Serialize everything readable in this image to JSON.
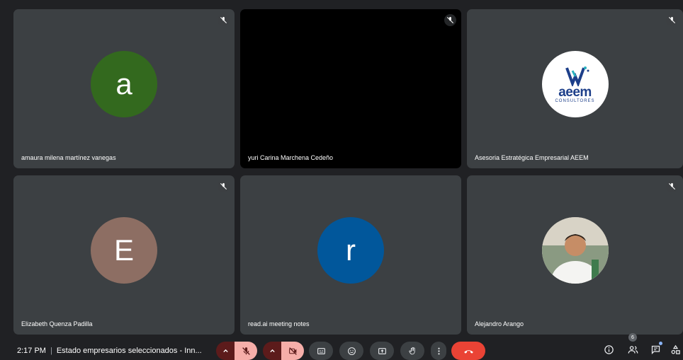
{
  "participants": [
    {
      "name": "amaura milena martínez vanegas",
      "initial": "a",
      "avatar_color": "#33691e",
      "muted": true
    },
    {
      "name": "yuri Carina Marchena Cedeño",
      "initial": "",
      "avatar_color": "#000000",
      "muted": true
    },
    {
      "name": "Asesoria Estratégica Empresarial AEEM",
      "logo_word": "aeem",
      "logo_sub": "CONSULTORES",
      "muted": true
    },
    {
      "name": "Elizabeth Quenza Padilla",
      "initial": "E",
      "avatar_color": "#8d6e63",
      "muted": true
    },
    {
      "name": "read.ai meeting notes",
      "initial": "r",
      "avatar_color": "#01579b",
      "muted": false
    },
    {
      "name": "Alejandro Arango",
      "photo": "profile photo",
      "muted": true
    }
  ],
  "bottom_bar": {
    "time": "2:17 PM",
    "separator": "|",
    "meeting_title": "Estado empresarios seleccionados - Inn...",
    "mic_state": "off",
    "camera_state": "off",
    "people_count": "6",
    "controls": [
      "microphone",
      "camera",
      "captions",
      "emoji-reactions",
      "present-screen",
      "raise-hand",
      "more-options",
      "leave-call"
    ],
    "right_controls": [
      "meeting-details",
      "people",
      "chat",
      "activities"
    ]
  },
  "colors": {
    "background": "#202124",
    "tile": "#3c4043",
    "hangup": "#ea4335",
    "muted_control": "#f6aea9",
    "muted_caret": "#5c1b1b"
  }
}
